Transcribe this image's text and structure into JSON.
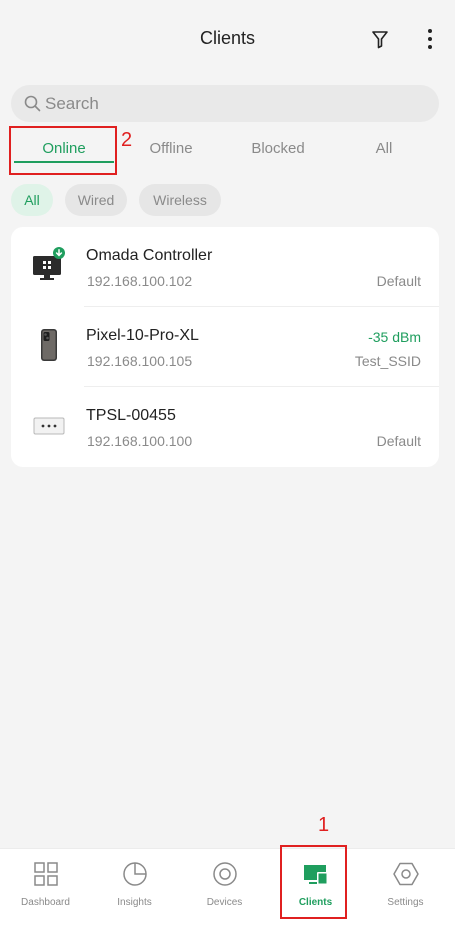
{
  "header": {
    "title": "Clients"
  },
  "search": {
    "placeholder": "Search"
  },
  "tabs": [
    {
      "label": "Online",
      "active": true
    },
    {
      "label": "Offline",
      "active": false
    },
    {
      "label": "Blocked",
      "active": false
    },
    {
      "label": "All",
      "active": false
    }
  ],
  "chips": [
    {
      "label": "All",
      "active": true
    },
    {
      "label": "Wired",
      "active": false
    },
    {
      "label": "Wireless",
      "active": false
    }
  ],
  "clients": [
    {
      "name": "Omada Controller",
      "ip": "192.168.100.102",
      "signal": "",
      "network": "Default",
      "icon": "controller-icon"
    },
    {
      "name": "Pixel-10-Pro-XL",
      "ip": "192.168.100.105",
      "signal": "-35 dBm",
      "network": "Test_SSID",
      "icon": "phone-icon"
    },
    {
      "name": "TPSL-00455",
      "ip": "192.168.100.100",
      "signal": "",
      "network": "Default",
      "icon": "generic-device-icon"
    }
  ],
  "nav": [
    {
      "label": "Dashboard",
      "icon": "dashboard-icon",
      "active": false
    },
    {
      "label": "Insights",
      "icon": "insights-icon",
      "active": false
    },
    {
      "label": "Devices",
      "icon": "devices-icon",
      "active": false
    },
    {
      "label": "Clients",
      "icon": "clients-icon",
      "active": true
    },
    {
      "label": "Settings",
      "icon": "settings-icon",
      "active": false
    }
  ],
  "annotations": {
    "marker_1": "1",
    "marker_2": "2"
  },
  "colors": {
    "accent": "#1f9e5e",
    "annotation": "#e02020",
    "background": "#f4f4f4"
  }
}
